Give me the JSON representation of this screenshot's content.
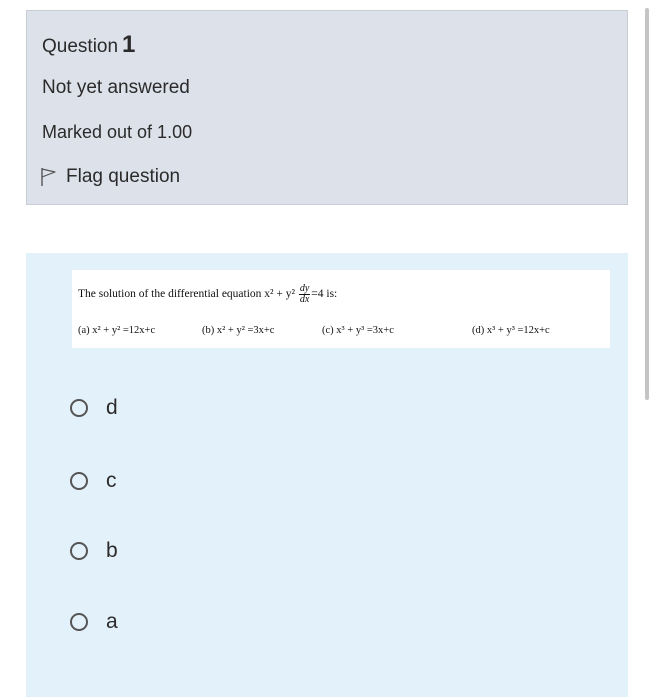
{
  "info": {
    "question_label": "Question",
    "question_number": "1",
    "state": "Not yet answered",
    "marks": "Marked out of 1.00",
    "flag_label": "Flag question",
    "flag_icon": "flag-outline-icon"
  },
  "question_image": {
    "stem_text": "The solution of the differential equation x² + y²",
    "frac_num": "dy",
    "frac_den": "dx",
    "stem_suffix": "=4 is:",
    "options": [
      "(a) x² + y² =12x+c",
      "(b) x² + y² =3x+c",
      "(c) x³ + y³ =3x+c",
      "(d) x³ + y³ =12x+c"
    ]
  },
  "answers": [
    {
      "label": "d"
    },
    {
      "label": "c"
    },
    {
      "label": "b"
    },
    {
      "label": "a"
    }
  ],
  "colors": {
    "info_bg": "#dde1ea",
    "content_bg": "#e3f1fa"
  }
}
